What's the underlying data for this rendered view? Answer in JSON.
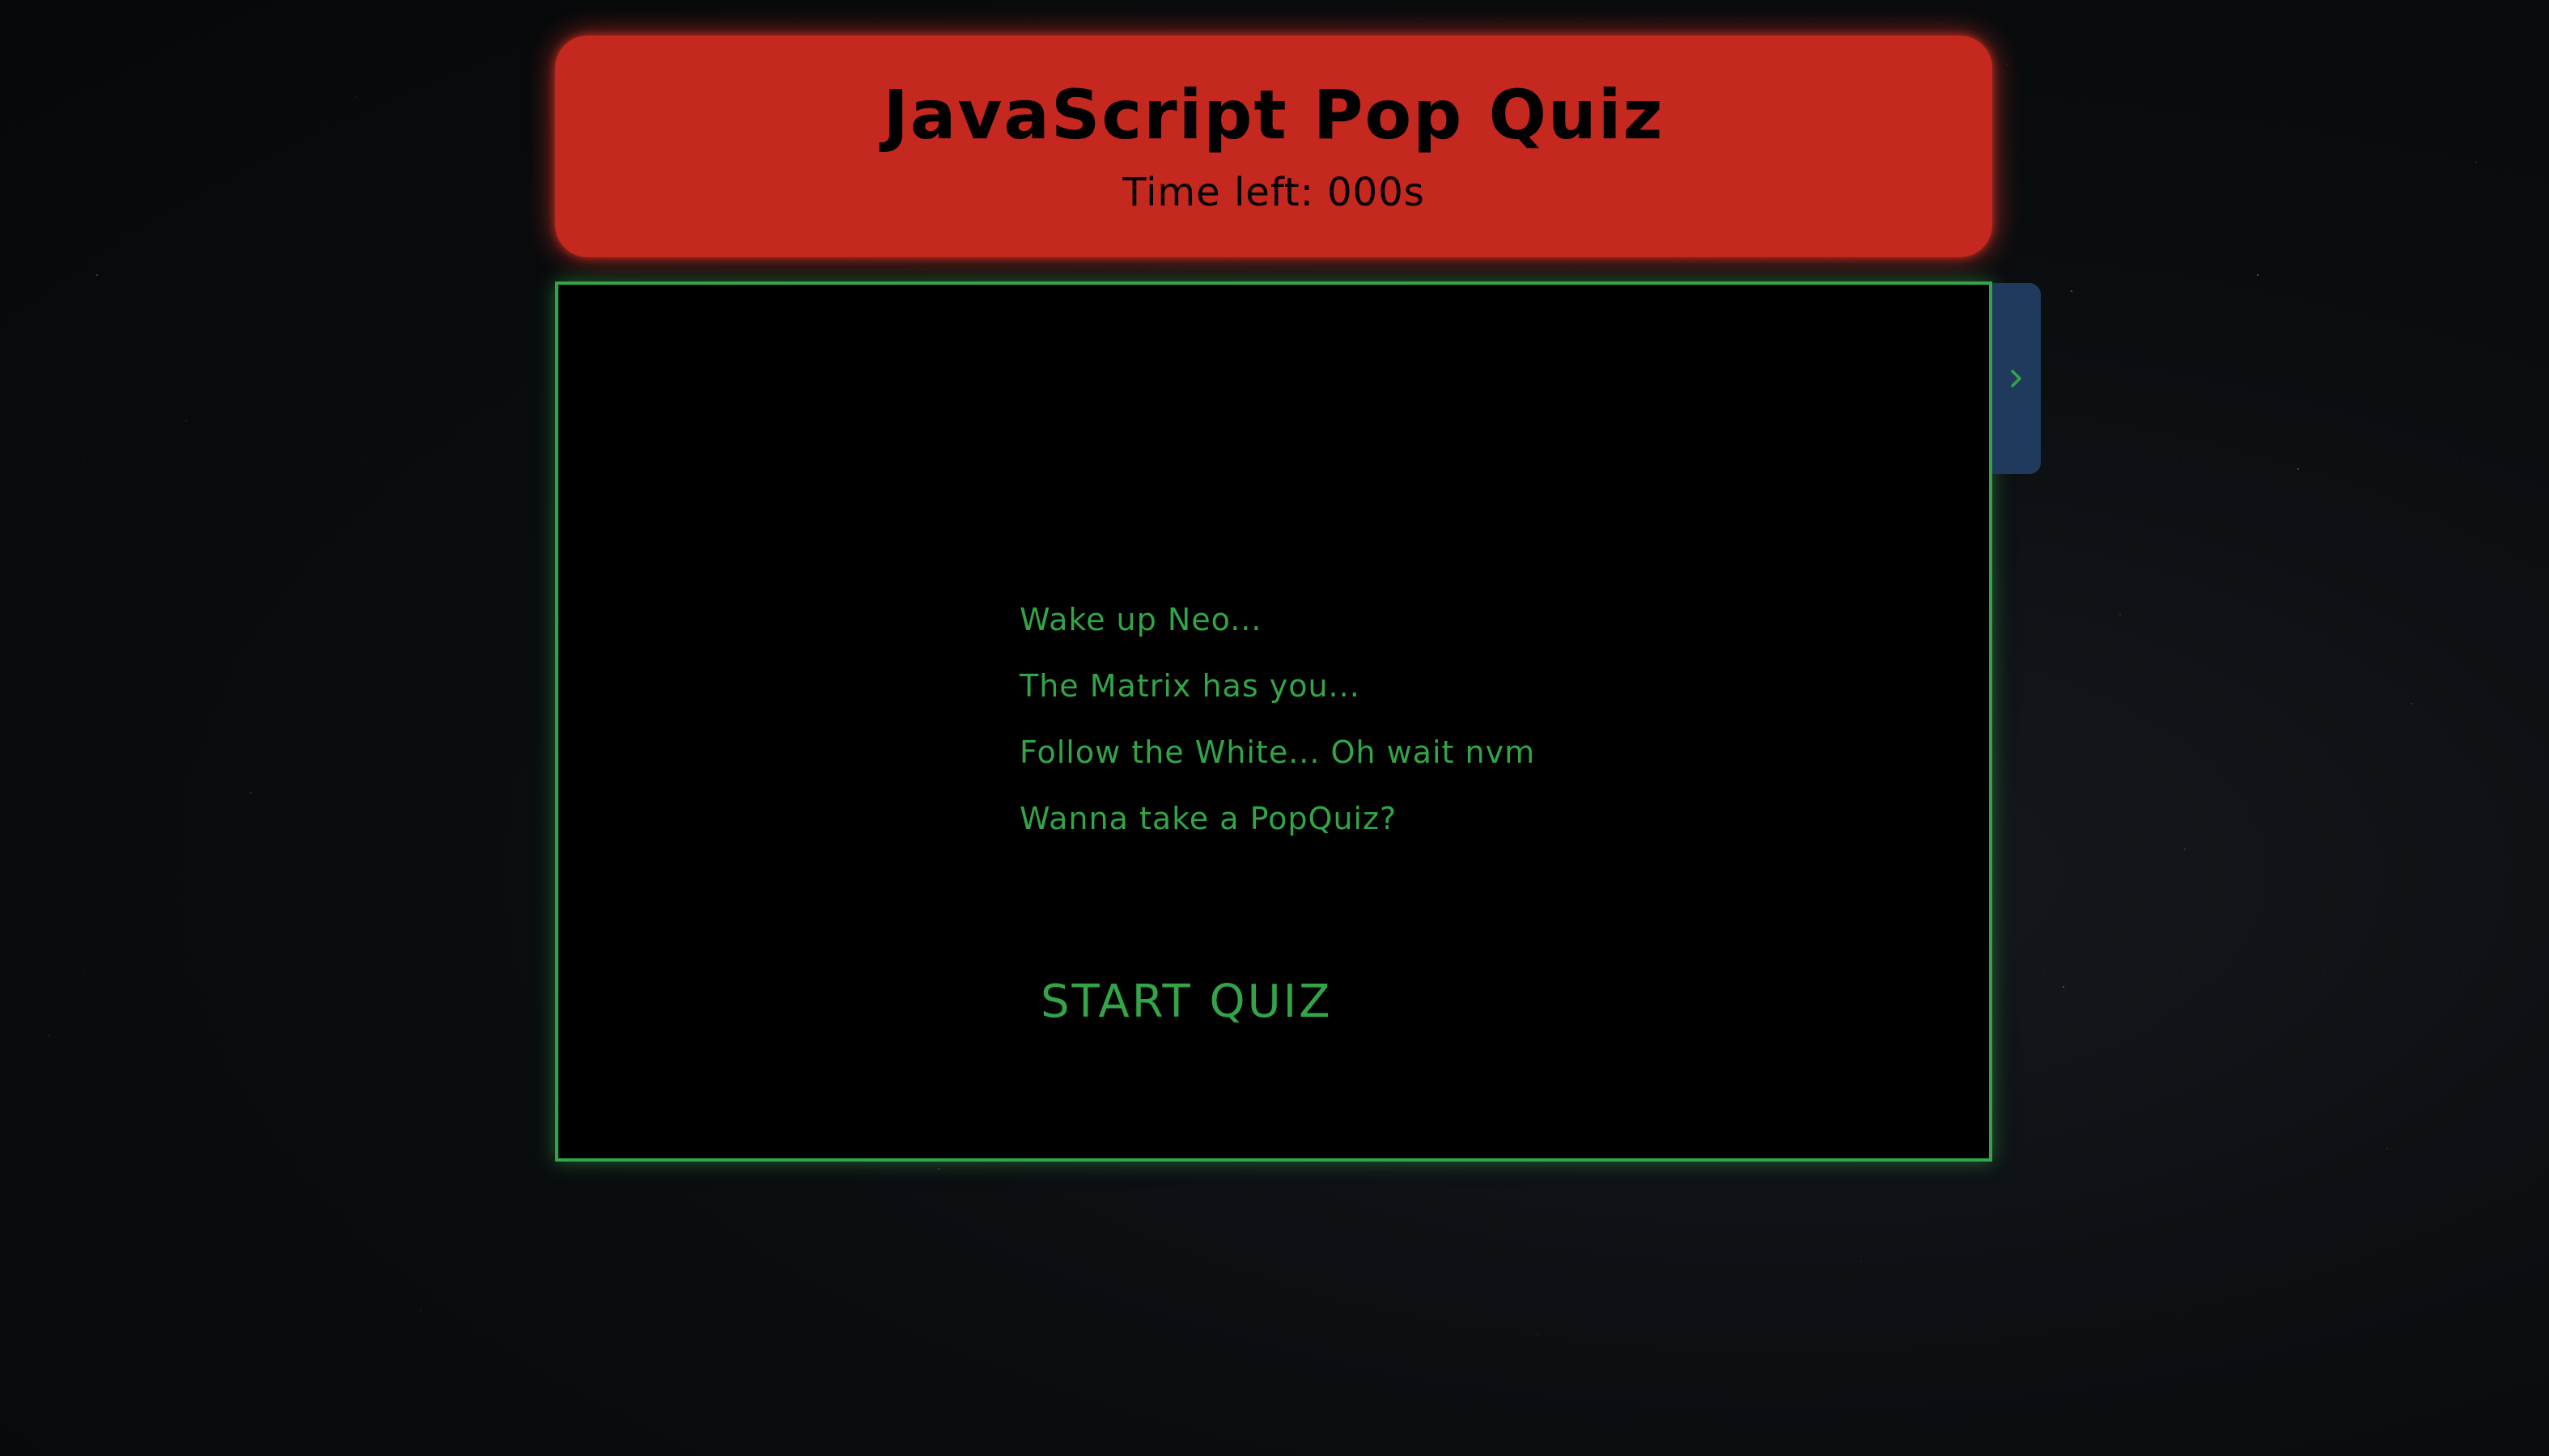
{
  "header": {
    "title": "JavaScript Pop Quiz",
    "timer_text": "Time left: 000s"
  },
  "panel": {
    "lines": [
      "Wake up Neo...",
      "The Matrix has you...",
      "Follow the White... Oh wait nvm",
      "Wanna take a PopQuiz?"
    ],
    "start_label": "START QUIZ"
  },
  "side_tab": {
    "icon": "chevron-right-icon"
  },
  "colors": {
    "header_bg": "#c4281f",
    "matrix_green": "#33a447",
    "panel_bg": "#000000",
    "side_tab_bg": "#1f3a5c",
    "page_bg": "#0b0e11"
  }
}
